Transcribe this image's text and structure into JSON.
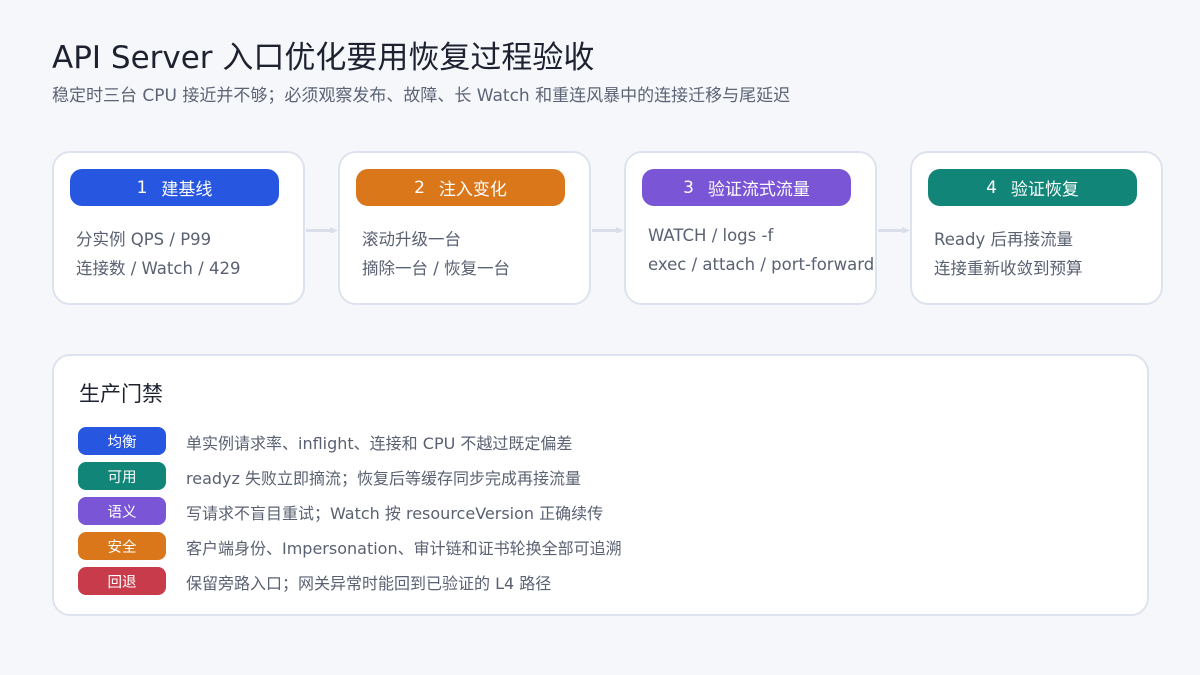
{
  "header": {
    "title": "API Server 入口优化要用恢复过程验收",
    "subtitle": "稳定时三台 CPU 接近并不够；必须观察发布、故障、长 Watch 和重连风暴中的连接迁移与尾延迟"
  },
  "steps": [
    {
      "num": "1",
      "label": "建基线",
      "color": "#2756e0",
      "lines": [
        "分实例 QPS / P99",
        "连接数 / Watch / 429"
      ]
    },
    {
      "num": "2",
      "label": "注入变化",
      "color": "#d9771a",
      "lines": [
        "滚动升级一台",
        "摘除一台 / 恢复一台"
      ]
    },
    {
      "num": "3",
      "label": "验证流式流量",
      "color": "#7a55d6",
      "lines": [
        "WATCH / logs -f",
        "exec / attach / port-forward"
      ]
    },
    {
      "num": "4",
      "label": "验证恢复",
      "color": "#118577",
      "lines": [
        "Ready 后再接流量",
        "连接重新收敛到预算"
      ]
    }
  ],
  "gate": {
    "title": "生产门禁",
    "rows": [
      {
        "tag": "均衡",
        "color": "#2756e0",
        "text": "单实例请求率、inflight、连接和 CPU 不越过既定偏差"
      },
      {
        "tag": "可用",
        "color": "#118577",
        "text": "readyz 失败立即摘流；恢复后等缓存同步完成再接流量"
      },
      {
        "tag": "语义",
        "color": "#7a55d6",
        "text": "写请求不盲目重试；Watch 按 resourceVersion 正确续传"
      },
      {
        "tag": "安全",
        "color": "#d9771a",
        "text": "客户端身份、Impersonation、审计链和证书轮换全部可追溯"
      },
      {
        "tag": "回退",
        "color": "#c83b4b",
        "text": "保留旁路入口；网关异常时能回到已验证的 L4 路径"
      }
    ]
  },
  "colors": {
    "arrow": "#d9dfea",
    "border": "#dde3ee",
    "background": "#f5f7fb"
  }
}
